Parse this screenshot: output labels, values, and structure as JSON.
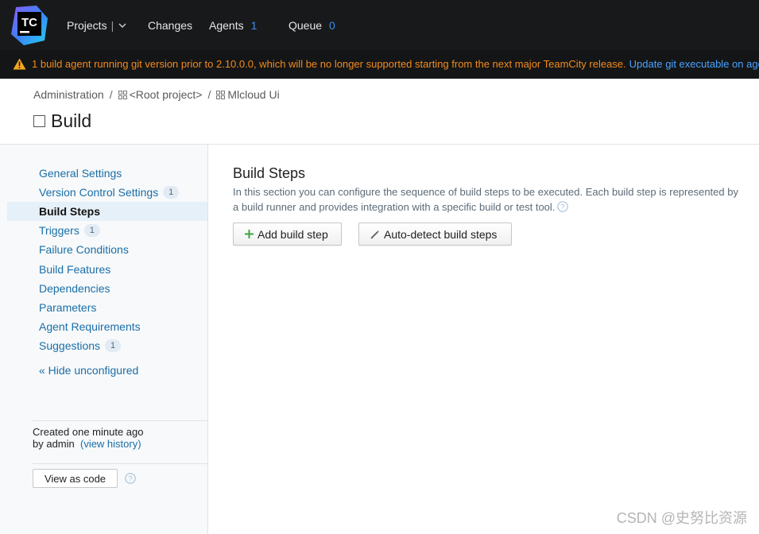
{
  "topbar": {
    "logo_text": "TC",
    "nav": {
      "projects": "Projects",
      "projects_sep": "|",
      "changes": "Changes",
      "agents": "Agents",
      "agents_count": "1",
      "queue": "Queue",
      "queue_count": "0"
    }
  },
  "warning": {
    "text": "1 build agent running git version prior to 2.10.0.0, which will be no longer supported starting from the next major TeamCity release.",
    "link": "Update git executable on agents",
    "color": "#f28b1d"
  },
  "breadcrumb": {
    "admin": "Administration",
    "sep": "/",
    "root": "<Root project>",
    "project": "Mlcloud Ui"
  },
  "page": {
    "title": "Build"
  },
  "sidebar": {
    "items": [
      {
        "label": "General Settings",
        "badge": "",
        "active": false
      },
      {
        "label": "Version Control Settings",
        "badge": "1",
        "active": false
      },
      {
        "label": "Build Steps",
        "badge": "",
        "active": true
      },
      {
        "label": "Triggers",
        "badge": "1",
        "active": false
      },
      {
        "label": "Failure Conditions",
        "badge": "",
        "active": false
      },
      {
        "label": "Build Features",
        "badge": "",
        "active": false
      },
      {
        "label": "Dependencies",
        "badge": "",
        "active": false
      },
      {
        "label": "Parameters",
        "badge": "",
        "active": false
      },
      {
        "label": "Agent Requirements",
        "badge": "",
        "active": false
      },
      {
        "label": "Suggestions",
        "badge": "1",
        "active": false
      }
    ],
    "hide_unconfigured": "« Hide unconfigured",
    "created_line1": "Created one minute ago",
    "created_by": "by admin",
    "view_history": "(view history)",
    "view_as_code": "View as code"
  },
  "main": {
    "section_title": "Build Steps",
    "section_desc": "In this section you can configure the sequence of build steps to be executed. Each build step is represented by a build runner and provides integration with a specific build or test tool.",
    "add_build_step": "Add build step",
    "auto_detect": "Auto-detect build steps"
  },
  "watermark": "CSDN @史努比资源",
  "colors": {
    "topbar_bg": "#18191b",
    "link_blue": "#1b6ea8",
    "count_blue": "#3e8bf0",
    "add_plus_green": "#3aa542"
  }
}
